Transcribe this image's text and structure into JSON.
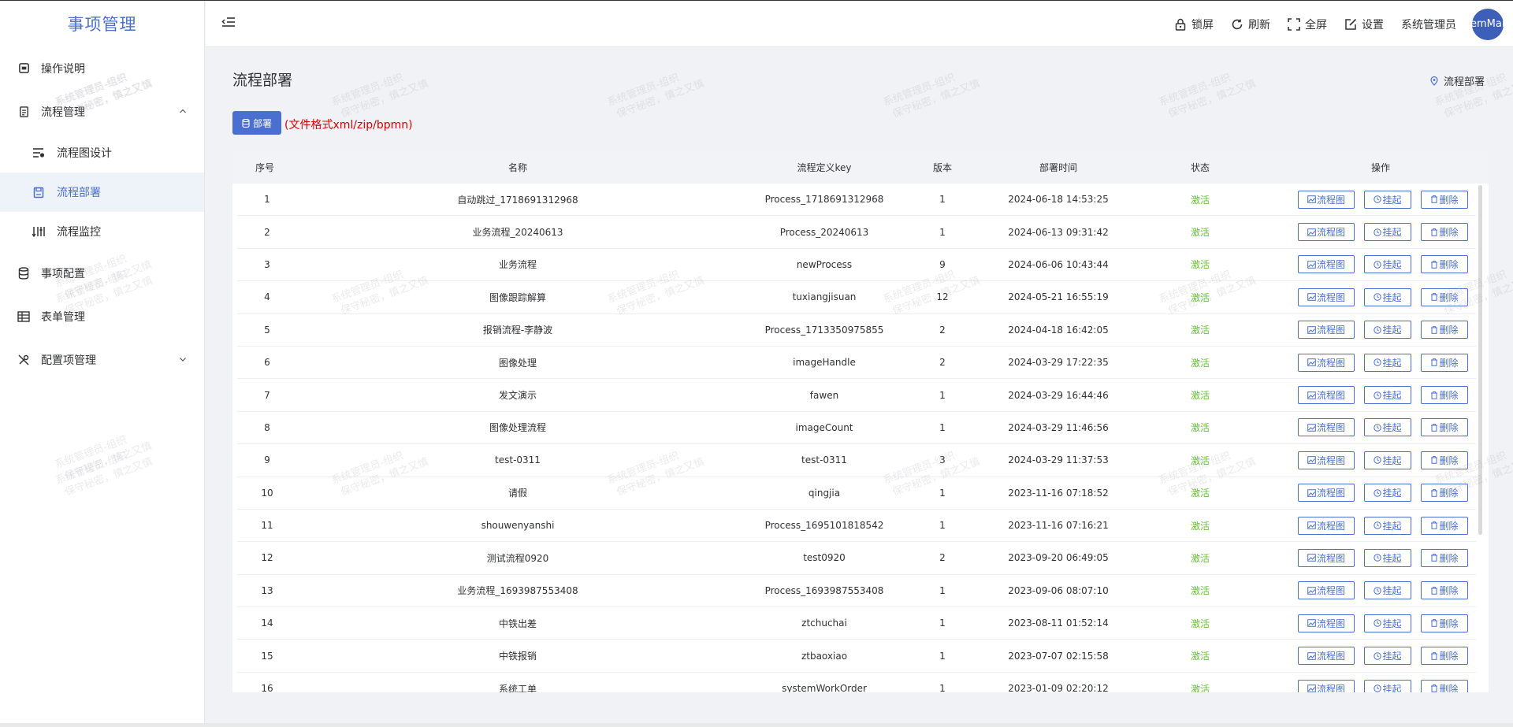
{
  "app": {
    "title": "事项管理"
  },
  "sidebar": {
    "items": [
      {
        "label": "操作说明",
        "icon": "calendar-icon"
      },
      {
        "label": "流程管理",
        "icon": "document-icon",
        "expanded": true,
        "children": [
          {
            "label": "流程图设计",
            "icon": "sliders-icon"
          },
          {
            "label": "流程部署",
            "icon": "save-icon",
            "active": true
          },
          {
            "label": "流程监控",
            "icon": "sort-icon"
          }
        ]
      },
      {
        "label": "事项配置",
        "icon": "database-icon"
      },
      {
        "label": "表单管理",
        "icon": "table-icon"
      },
      {
        "label": "配置项管理",
        "icon": "tools-icon",
        "expanded": false
      }
    ]
  },
  "header": {
    "actions": [
      {
        "label": "锁屏",
        "icon": "lock-icon"
      },
      {
        "label": "刷新",
        "icon": "refresh-icon"
      },
      {
        "label": "全屏",
        "icon": "fullscreen-icon"
      },
      {
        "label": "设置",
        "icon": "edit-icon"
      }
    ],
    "user_name": "系统管理员",
    "avatar_text": "emMan"
  },
  "page": {
    "title": "流程部署",
    "breadcrumb": "流程部署",
    "deploy_button": "部署",
    "deploy_hint": "(文件格式xml/zip/bpmn)"
  },
  "table": {
    "columns": [
      "序号",
      "名称",
      "流程定义key",
      "版本",
      "部署时间",
      "状态",
      "操作"
    ],
    "op_labels": {
      "diagram": "流程图",
      "suspend": "挂起",
      "delete": "删除"
    },
    "rows": [
      {
        "idx": "1",
        "name": "自动跳过_1718691312968",
        "key": "Process_1718691312968",
        "version": "1",
        "time": "2024-06-18 14:53:25",
        "status": "激活"
      },
      {
        "idx": "2",
        "name": "业务流程_20240613",
        "key": "Process_20240613",
        "version": "1",
        "time": "2024-06-13 09:31:42",
        "status": "激活"
      },
      {
        "idx": "3",
        "name": "业务流程",
        "key": "newProcess",
        "version": "9",
        "time": "2024-06-06 10:43:44",
        "status": "激活"
      },
      {
        "idx": "4",
        "name": "图像跟踪解算",
        "key": "tuxiangjisuan",
        "version": "12",
        "time": "2024-05-21 16:55:19",
        "status": "激活"
      },
      {
        "idx": "5",
        "name": "报销流程-李静波",
        "key": "Process_1713350975855",
        "version": "2",
        "time": "2024-04-18 16:42:05",
        "status": "激活"
      },
      {
        "idx": "6",
        "name": "图像处理",
        "key": "imageHandle",
        "version": "2",
        "time": "2024-03-29 17:22:35",
        "status": "激活"
      },
      {
        "idx": "7",
        "name": "发文演示",
        "key": "fawen",
        "version": "1",
        "time": "2024-03-29 16:44:46",
        "status": "激活"
      },
      {
        "idx": "8",
        "name": "图像处理流程",
        "key": "imageCount",
        "version": "1",
        "time": "2024-03-29 11:46:56",
        "status": "激活"
      },
      {
        "idx": "9",
        "name": "test-0311",
        "key": "test-0311",
        "version": "3",
        "time": "2024-03-29 11:37:53",
        "status": "激活"
      },
      {
        "idx": "10",
        "name": "请假",
        "key": "qingjia",
        "version": "1",
        "time": "2023-11-16 07:18:52",
        "status": "激活"
      },
      {
        "idx": "11",
        "name": "shouwenyanshi",
        "key": "Process_1695101818542",
        "version": "1",
        "time": "2023-11-16 07:16:21",
        "status": "激活"
      },
      {
        "idx": "12",
        "name": "测试流程0920",
        "key": "test0920",
        "version": "2",
        "time": "2023-09-20 06:49:05",
        "status": "激活"
      },
      {
        "idx": "13",
        "name": "业务流程_1693987553408",
        "key": "Process_1693987553408",
        "version": "1",
        "time": "2023-09-06 08:07:10",
        "status": "激活"
      },
      {
        "idx": "14",
        "name": "中铁出差",
        "key": "ztchuchai",
        "version": "1",
        "time": "2023-08-11 01:52:14",
        "status": "激活"
      },
      {
        "idx": "15",
        "name": "中铁报销",
        "key": "ztbaoxiao",
        "version": "1",
        "time": "2023-07-07 02:15:58",
        "status": "激活"
      },
      {
        "idx": "16",
        "name": "系统工单",
        "key": "systemWorkOrder",
        "version": "1",
        "time": "2023-01-09 02:20:12",
        "status": "激活"
      }
    ]
  },
  "watermark": {
    "line1": "系统管理员-组织",
    "line2": "保守秘密，慎之又慎"
  },
  "colors": {
    "accent": "#4a6fd1",
    "active_status": "#67c23a",
    "hint": "#e00000"
  }
}
